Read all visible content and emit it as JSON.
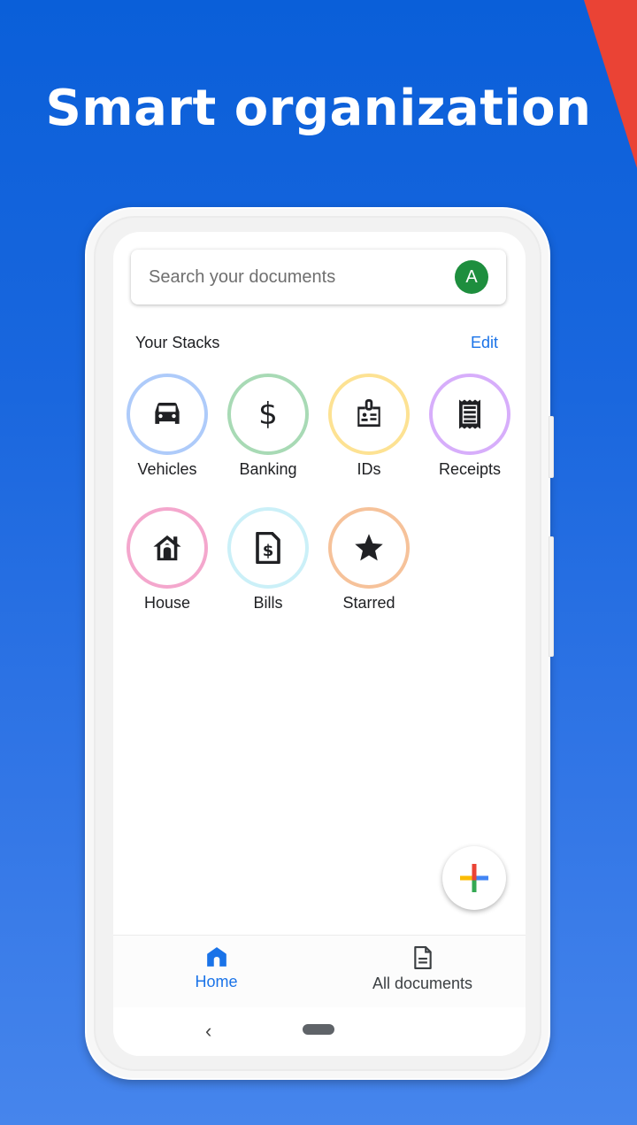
{
  "headline": "Smart organization",
  "search": {
    "placeholder": "Search your documents",
    "avatar_initial": "A",
    "avatar_color": "#1e8e3e"
  },
  "stacks_section": {
    "title": "Your Stacks",
    "edit_label": "Edit"
  },
  "stacks": [
    {
      "label": "Vehicles",
      "icon": "car-icon",
      "ring_color": "#aecbfa"
    },
    {
      "label": "Banking",
      "icon": "dollar-icon",
      "ring_color": "#a8dab5"
    },
    {
      "label": "IDs",
      "icon": "id-badge-icon",
      "ring_color": "#fde293"
    },
    {
      "label": "Receipts",
      "icon": "receipt-icon",
      "ring_color": "#d7aefb"
    },
    {
      "label": "House",
      "icon": "house-icon",
      "ring_color": "#f4a7cd"
    },
    {
      "label": "Bills",
      "icon": "bill-icon",
      "ring_color": "#cbf0f8"
    },
    {
      "label": "Starred",
      "icon": "star-icon",
      "ring_color": "#f6c29a"
    }
  ],
  "fab": {
    "icon": "google-plus-icon"
  },
  "bottom_nav": [
    {
      "label": "Home",
      "icon": "home-icon",
      "active": true
    },
    {
      "label": "All documents",
      "icon": "document-icon",
      "active": false
    }
  ],
  "system_nav": {
    "back": "‹"
  },
  "colors": {
    "accent": "#1a73e8",
    "background_top": "#0a5fd9",
    "background_bottom": "#4685ec",
    "corner_red": "#ea4335"
  }
}
